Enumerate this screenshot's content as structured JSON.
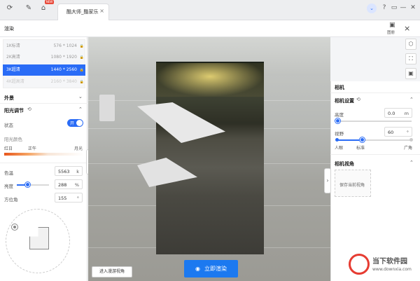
{
  "topbar": {
    "new_badge": "NEW",
    "tab_title": "酷大师_酷家乐",
    "tab_close": "×",
    "window_buttons": [
      "?",
      "▭",
      "—",
      "▢",
      "✕"
    ]
  },
  "header": {
    "title": "渲染",
    "gallery_label": "图册",
    "close": "×"
  },
  "resolutions": [
    {
      "name": "1K标清",
      "value": "576 * 1024",
      "state": "normal"
    },
    {
      "name": "2K高清",
      "value": "1080 * 1920",
      "state": "normal"
    },
    {
      "name": "3K超清",
      "value": "1440 * 2560",
      "state": "selected"
    },
    {
      "name": "4K超高清",
      "value": "2160 * 3840",
      "state": "disabled"
    }
  ],
  "exterior": {
    "label": "外景"
  },
  "sunlight": {
    "title": "阳光调节",
    "status_label": "状态",
    "toggle_label": "开",
    "color_label": "阳光颜色",
    "scale_labels": [
      "红日",
      "正午",
      "月光"
    ],
    "color_temp_label": "色温",
    "color_temp_value": "5563",
    "color_temp_unit": "k",
    "brightness_label": "亮度",
    "brightness_value": "288",
    "brightness_unit": "%",
    "brightness_level": 0.32,
    "azimuth_label": "方位角",
    "azimuth_value": "155",
    "azimuth_unit": "°"
  },
  "camera": {
    "title": "相机",
    "settings_title": "相机设置",
    "height_label": "高度",
    "height_value": "0.0",
    "height_unit": "m",
    "fov_label": "视野",
    "fov_value": "60",
    "fov_unit": "°",
    "fov_marks": [
      "人眼",
      "标准",
      "广角"
    ],
    "view_title": "相机视角",
    "save_view_label": "保存当前视角"
  },
  "actions": {
    "roam_label": "进入漫游视角",
    "render_label": "立即渲染"
  },
  "watermark": {
    "text": "当下软件园",
    "url": "www.downxia.com"
  }
}
